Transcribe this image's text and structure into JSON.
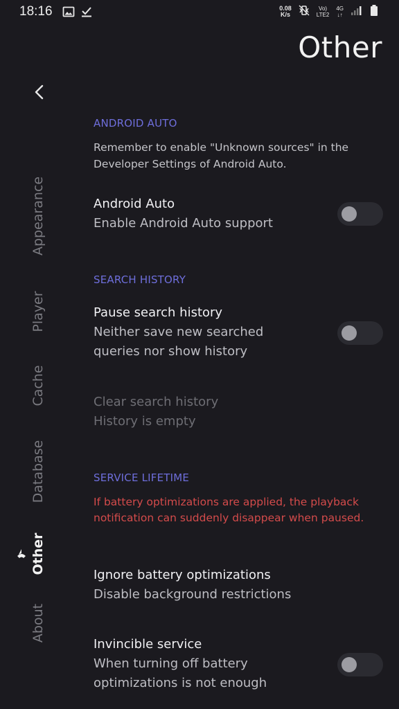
{
  "status_bar": {
    "time": "18:16",
    "net_speed_value": "0.08",
    "net_speed_unit": "K/s",
    "volte_top": "Vo)",
    "volte_bottom": "LTE2",
    "network_type": "4G",
    "icons": [
      "image-icon",
      "download-done-icon",
      "vibrate-icon",
      "signal-icon",
      "battery-icon"
    ]
  },
  "header": {
    "title": "Other"
  },
  "nav": {
    "items": [
      {
        "label": "Appearance",
        "active": false
      },
      {
        "label": "Player",
        "active": false
      },
      {
        "label": "Cache",
        "active": false
      },
      {
        "label": "Database",
        "active": false
      },
      {
        "label": "Other",
        "active": true
      },
      {
        "label": "About",
        "active": false
      }
    ]
  },
  "sections": {
    "android_auto": {
      "header": "ANDROID AUTO",
      "note": "Remember to enable \"Unknown sources\" in the Developer Settings of Android Auto.",
      "android_auto_pref": {
        "title": "Android Auto",
        "summary": "Enable Android Auto support",
        "enabled": false
      }
    },
    "search_history": {
      "header": "SEARCH HISTORY",
      "pause_pref": {
        "title": "Pause search history",
        "summary": "Neither save new searched queries nor show history",
        "enabled": false
      },
      "clear_pref": {
        "title": "Clear search history",
        "summary": "History is empty"
      }
    },
    "service_lifetime": {
      "header": "SERVICE LIFETIME",
      "warning": "If battery optimizations are applied, the playback notification can suddenly disappear when paused.",
      "ignore_pref": {
        "title": "Ignore battery optimizations",
        "summary": "Disable background restrictions"
      },
      "invincible_pref": {
        "title": "Invincible service",
        "summary": "When turning off battery optimizations is not enough",
        "enabled": false
      }
    }
  },
  "colors": {
    "background": "#1b1a1f",
    "accent": "#6e6edb",
    "warning": "#d44b4b"
  }
}
